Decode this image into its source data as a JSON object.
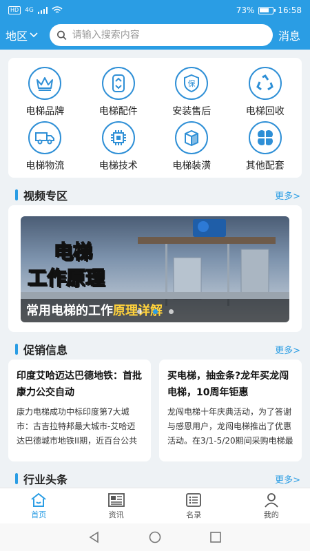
{
  "status_bar": {
    "signal_badge": "HD",
    "network": "4G",
    "battery": "73%",
    "time": "16:58"
  },
  "header": {
    "region_label": "地区",
    "search_placeholder": "请输入搜索内容",
    "messages_label": "消息"
  },
  "categories": [
    {
      "label": "电梯品牌",
      "icon": "crown-icon"
    },
    {
      "label": "电梯配件",
      "icon": "elevator-buttons-icon"
    },
    {
      "label": "安装售后",
      "icon": "shield-icon"
    },
    {
      "label": "电梯回收",
      "icon": "recycle-icon"
    },
    {
      "label": "电梯物流",
      "icon": "truck-icon"
    },
    {
      "label": "电梯技术",
      "icon": "chip-icon"
    },
    {
      "label": "电梯装潢",
      "icon": "box-icon"
    },
    {
      "label": "其他配套",
      "icon": "grid-petals-icon"
    }
  ],
  "video_section": {
    "title": "视频专区",
    "more": "更多>",
    "video": {
      "title_line1": "电梯",
      "title_line2": "工作原理",
      "subtitle_plain": "常用电梯的工作",
      "subtitle_highlight": "原理详解"
    },
    "carousel_dots": 3,
    "active_dot": 1
  },
  "promo_section": {
    "title": "促销信息",
    "more": "更多>",
    "items": [
      {
        "title": "印度艾哈迈达巴德地铁：首批康力公交自动",
        "body": "康力电梯成功中标印度第7大城市：古吉拉特邦最大城市-艾哈迈达巴德城市地铁II期，近百台公共交通型自动扶梯"
      },
      {
        "title": "买电梯，抽金条?龙年买龙闯电梯，10周年钜惠",
        "body": "龙闯电梯十年庆典活动，为了答谢与感恩用户，龙闯电梯推出了优惠活动。在3/1-5/20期间采购电梯最高享受"
      }
    ]
  },
  "news_section": {
    "title": "行业头条",
    "more": "更多>"
  },
  "tabs": [
    {
      "label": "首页",
      "icon": "home-icon",
      "active": true
    },
    {
      "label": "资讯",
      "icon": "newspaper-icon",
      "active": false
    },
    {
      "label": "名录",
      "icon": "list-icon",
      "active": false
    },
    {
      "label": "我的",
      "icon": "user-icon",
      "active": false
    }
  ],
  "colors": {
    "primary": "#2a9de4",
    "icon_stroke": "#2e8fd6",
    "background": "#eef2f5",
    "highlight": "#ffd23c"
  }
}
